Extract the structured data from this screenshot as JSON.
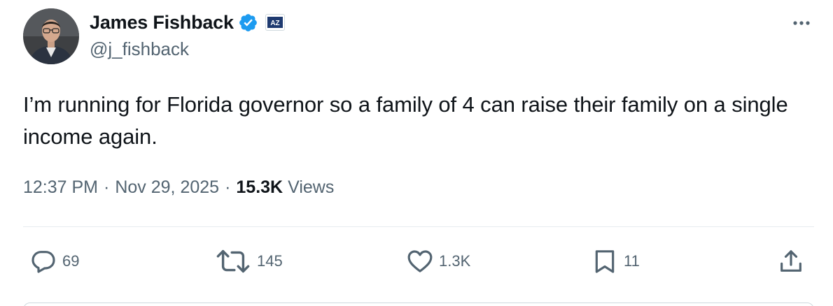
{
  "author": {
    "display_name": "James Fishback",
    "handle": "@j_fishback",
    "verified_icon": "verified-badge-icon",
    "affiliate_icon": "affiliate-badge-icon",
    "verified_color": "#1d9bf0"
  },
  "tweet": {
    "text": "I’m running for Florida governor so a family of 4 can raise their family on a single income again.",
    "time": "12:37 PM",
    "date": "Nov 29, 2025",
    "separator": "·",
    "views_count": "15.3K",
    "views_label": "Views"
  },
  "actions": {
    "replies": "69",
    "reposts": "145",
    "likes": "1.3K",
    "bookmarks": "11"
  },
  "colors": {
    "text_primary": "#0f1419",
    "text_secondary": "#536471",
    "divider": "#e6ecf0"
  }
}
